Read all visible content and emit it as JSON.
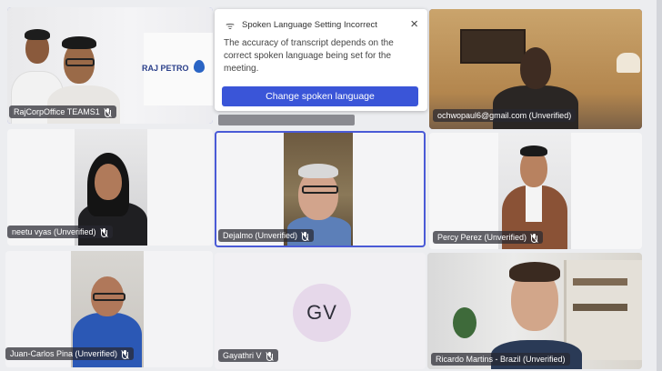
{
  "notification": {
    "title": "Spoken Language Setting Incorrect",
    "icon": "speech-icon",
    "close": "×",
    "body": "The accuracy of transcript depends on the correct spoken language being set for the meeting.",
    "button": "Change spoken language"
  },
  "participants": [
    {
      "id": "rajcorp",
      "name": "RajCorpOffice TEAMS1",
      "muted": true,
      "logo": "RAJ PETRO"
    },
    {
      "id": "ochwo",
      "name": "ochwopaul6@gmail.com (Unverified)",
      "muted": false
    },
    {
      "id": "neetu",
      "name": "neetu vyas (Unverified)",
      "muted": true
    },
    {
      "id": "dejalmo",
      "name": "Dejalmo (Unverified)",
      "muted": true
    },
    {
      "id": "percy",
      "name": "Percy Perez (Unverified)",
      "muted": true
    },
    {
      "id": "juancarlos",
      "name": "Juan-Carlos Pina (Unverified)",
      "muted": true
    },
    {
      "id": "gayathri",
      "name": "Gayathri V",
      "muted": true,
      "initials": "GV"
    },
    {
      "id": "ricardo",
      "name": "Ricardo Martins - Brazil (Unverified)",
      "muted": false
    }
  ],
  "colors": {
    "accent": "#3a55d8",
    "active_border": "#4a5ad6",
    "avatar_bg": "#e6d8ea"
  }
}
